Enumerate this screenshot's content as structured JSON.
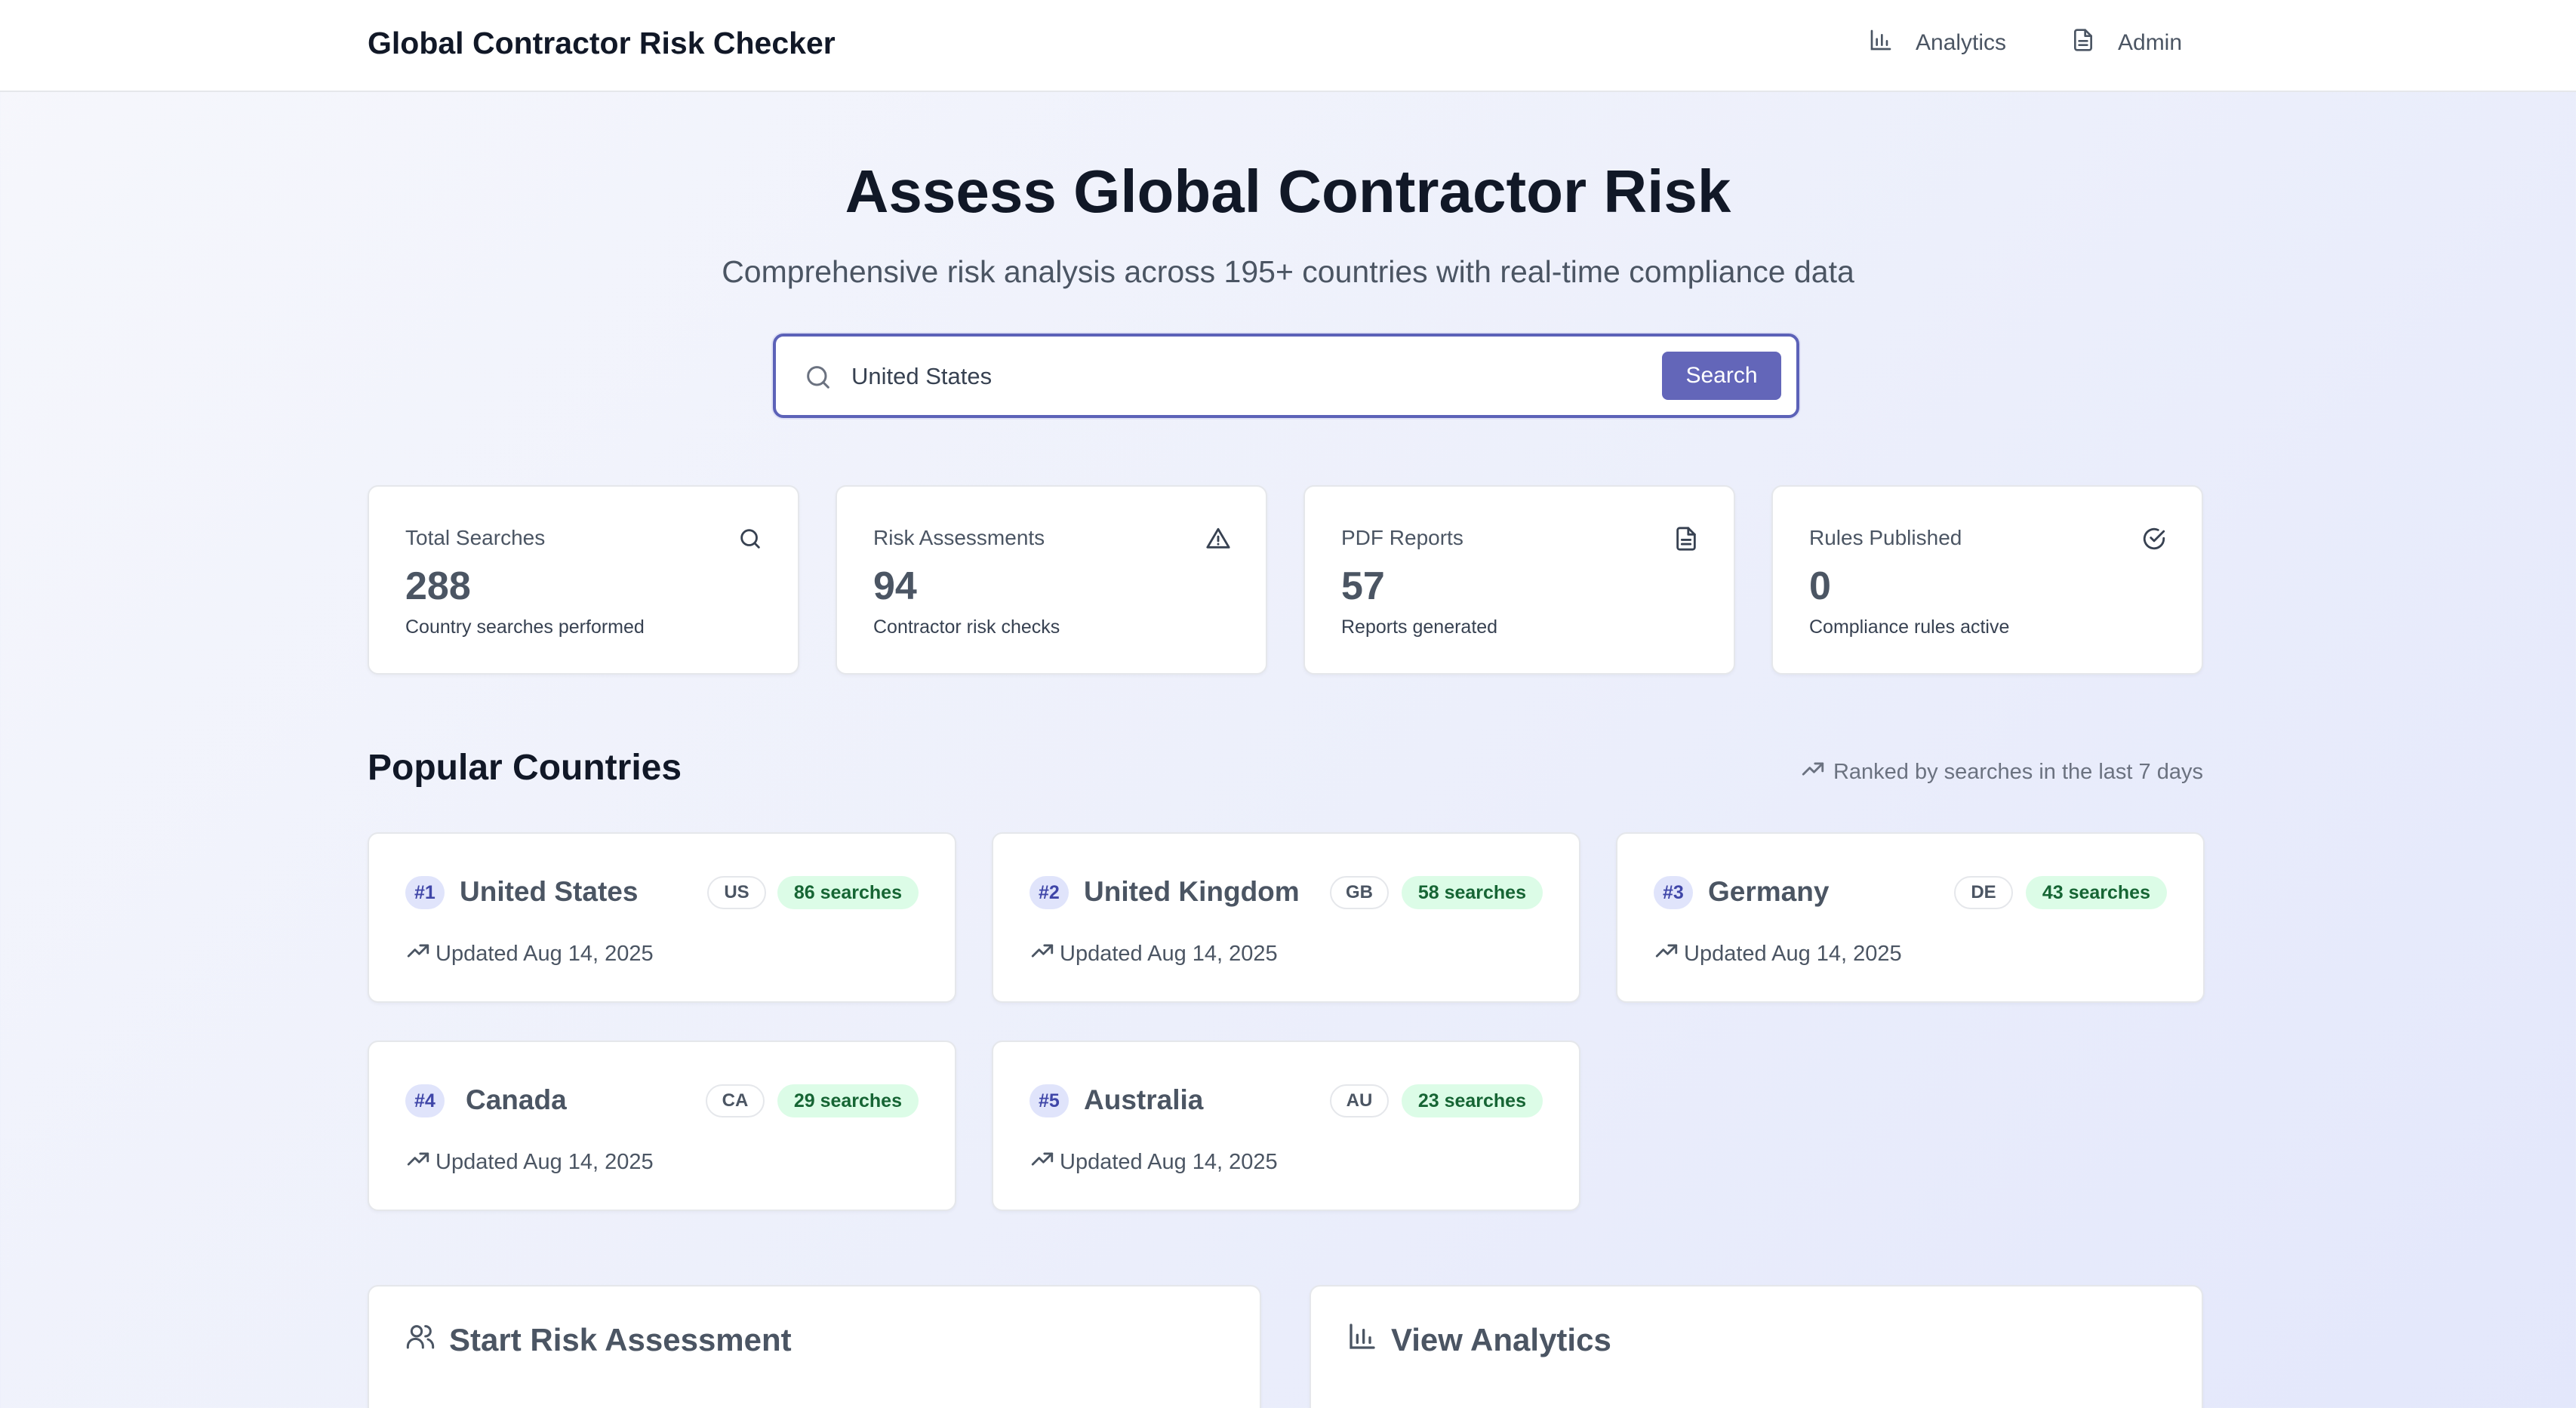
{
  "header": {
    "brand": "Global Contractor Risk Checker",
    "nav": [
      {
        "label": "Analytics",
        "icon": "bar-chart-icon"
      },
      {
        "label": "Admin",
        "icon": "document-icon"
      }
    ]
  },
  "hero": {
    "title": "Assess Global Contractor Risk",
    "subtitle": "Comprehensive risk analysis across 195+ countries with real-time compliance data"
  },
  "search": {
    "value": "United States",
    "button_label": "Search",
    "icon": "search-icon"
  },
  "stats": [
    {
      "label": "Total Searches",
      "value": "288",
      "desc": "Country searches performed",
      "icon": "search-icon"
    },
    {
      "label": "Risk Assessments",
      "value": "94",
      "desc": "Contractor risk checks",
      "icon": "warning-triangle-icon"
    },
    {
      "label": "PDF Reports",
      "value": "57",
      "desc": "Reports generated",
      "icon": "document-icon"
    },
    {
      "label": "Rules Published",
      "value": "0",
      "desc": "Compliance rules active",
      "icon": "check-circle-icon"
    }
  ],
  "popular": {
    "title": "Popular Countries",
    "meta": "Ranked by searches in the last 7 days",
    "countries": [
      {
        "rank": "#1",
        "name": "United States",
        "code": "US",
        "searches": "86 searches",
        "updated": "Updated Aug 14, 2025"
      },
      {
        "rank": "#2",
        "name": "United Kingdom",
        "code": "GB",
        "searches": "58 searches",
        "updated": "Updated Aug 14, 2025"
      },
      {
        "rank": "#3",
        "name": "Germany",
        "code": "DE",
        "searches": "43 searches",
        "updated": "Updated Aug 14, 2025"
      },
      {
        "rank": "#4",
        "name": "Canada",
        "code": "CA",
        "searches": "29 searches",
        "updated": "Updated Aug 14, 2025"
      },
      {
        "rank": "#5",
        "name": "Australia",
        "code": "AU",
        "searches": "23 searches",
        "updated": "Updated Aug 14, 2025"
      }
    ]
  },
  "actions": [
    {
      "label": "Start Risk Assessment",
      "icon": "users-icon"
    },
    {
      "label": "View Analytics",
      "icon": "bar-chart-icon"
    }
  ],
  "colors": {
    "accent": "#6366b9",
    "search_border": "#5c62b8",
    "rank_badge_bg": "#e0e4fb",
    "searches_badge_bg": "#dcfce7",
    "searches_badge_text": "#166534"
  }
}
